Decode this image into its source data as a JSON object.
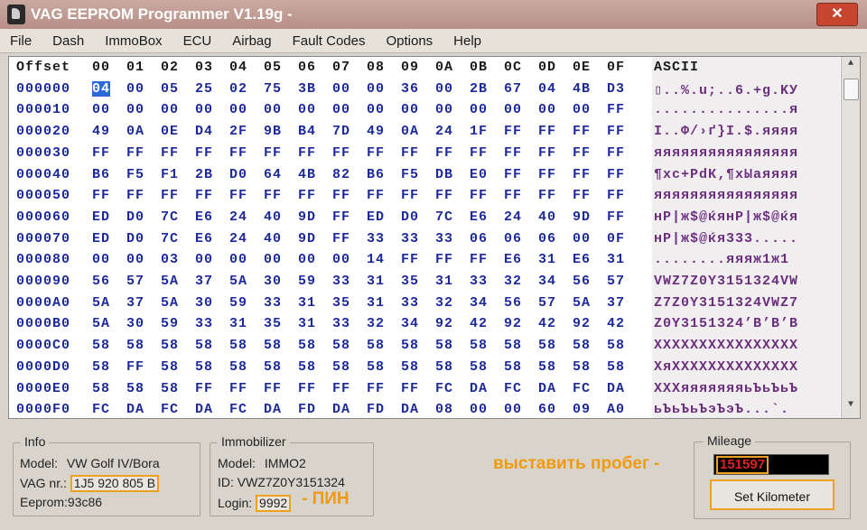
{
  "window": {
    "title": "VAG EEPROM Programmer  V1.19g -",
    "close_label": "✕"
  },
  "menu": [
    "File",
    "Dash",
    "ImmoBox",
    "ECU",
    "Airbag",
    "Fault Codes",
    "Options",
    "Help"
  ],
  "hex_view": {
    "header": [
      "Offset",
      "00",
      "01",
      "02",
      "03",
      "04",
      "05",
      "06",
      "07",
      "08",
      "09",
      "0A",
      "0B",
      "0C",
      "0D",
      "0E",
      "0F"
    ],
    "ascii_header": "ASCII",
    "rows": [
      {
        "offset": "000000",
        "bytes": [
          "04",
          "00",
          "05",
          "25",
          "02",
          "75",
          "3B",
          "00",
          "00",
          "36",
          "00",
          "2B",
          "67",
          "04",
          "4B",
          "D3"
        ],
        "ascii": "▯..%.u;..6.+g.KУ"
      },
      {
        "offset": "000010",
        "bytes": [
          "00",
          "00",
          "00",
          "00",
          "00",
          "00",
          "00",
          "00",
          "00",
          "00",
          "00",
          "00",
          "00",
          "00",
          "00",
          "FF"
        ],
        "ascii": "...............я"
      },
      {
        "offset": "000020",
        "bytes": [
          "49",
          "0A",
          "0E",
          "D4",
          "2F",
          "9B",
          "B4",
          "7D",
          "49",
          "0A",
          "24",
          "1F",
          "FF",
          "FF",
          "FF",
          "FF"
        ],
        "ascii": "I..Ф/›ґ}I.$.яяяя"
      },
      {
        "offset": "000030",
        "bytes": [
          "FF",
          "FF",
          "FF",
          "FF",
          "FF",
          "FF",
          "FF",
          "FF",
          "FF",
          "FF",
          "FF",
          "FF",
          "FF",
          "FF",
          "FF",
          "FF"
        ],
        "ascii": "яяяяяяяяяяяяяяяя"
      },
      {
        "offset": "000040",
        "bytes": [
          "B6",
          "F5",
          "F1",
          "2B",
          "D0",
          "64",
          "4B",
          "82",
          "B6",
          "F5",
          "DB",
          "E0",
          "FF",
          "FF",
          "FF",
          "FF"
        ],
        "ascii": "¶хс+РdК‚¶хЫаяяяя"
      },
      {
        "offset": "000050",
        "bytes": [
          "FF",
          "FF",
          "FF",
          "FF",
          "FF",
          "FF",
          "FF",
          "FF",
          "FF",
          "FF",
          "FF",
          "FF",
          "FF",
          "FF",
          "FF",
          "FF"
        ],
        "ascii": "яяяяяяяяяяяяяяяя"
      },
      {
        "offset": "000060",
        "bytes": [
          "ED",
          "D0",
          "7C",
          "E6",
          "24",
          "40",
          "9D",
          "FF",
          "ED",
          "D0",
          "7C",
          "E6",
          "24",
          "40",
          "9D",
          "FF"
        ],
        "ascii": "нР|ж$@ќянР|ж$@ќя"
      },
      {
        "offset": "000070",
        "bytes": [
          "ED",
          "D0",
          "7C",
          "E6",
          "24",
          "40",
          "9D",
          "FF",
          "33",
          "33",
          "33",
          "06",
          "06",
          "06",
          "00",
          "0F"
        ],
        "ascii": "нР|ж$@ќя333....."
      },
      {
        "offset": "000080",
        "bytes": [
          "00",
          "00",
          "03",
          "00",
          "00",
          "00",
          "00",
          "00",
          "14",
          "FF",
          "FF",
          "FF",
          "E6",
          "31",
          "E6",
          "31"
        ],
        "ascii": "........яяяж1ж1"
      },
      {
        "offset": "000090",
        "bytes": [
          "56",
          "57",
          "5A",
          "37",
          "5A",
          "30",
          "59",
          "33",
          "31",
          "35",
          "31",
          "33",
          "32",
          "34",
          "56",
          "57"
        ],
        "ascii": "VWZ7Z0Y3151324VW"
      },
      {
        "offset": "0000A0",
        "bytes": [
          "5A",
          "37",
          "5A",
          "30",
          "59",
          "33",
          "31",
          "35",
          "31",
          "33",
          "32",
          "34",
          "56",
          "57",
          "5A",
          "37"
        ],
        "ascii": "Z7Z0Y3151324VWZ7"
      },
      {
        "offset": "0000B0",
        "bytes": [
          "5A",
          "30",
          "59",
          "33",
          "31",
          "35",
          "31",
          "33",
          "32",
          "34",
          "92",
          "42",
          "92",
          "42",
          "92",
          "42"
        ],
        "ascii": "Z0Y3151324’B’B’B"
      },
      {
        "offset": "0000C0",
        "bytes": [
          "58",
          "58",
          "58",
          "58",
          "58",
          "58",
          "58",
          "58",
          "58",
          "58",
          "58",
          "58",
          "58",
          "58",
          "58",
          "58"
        ],
        "ascii": "XXXXXXXXXXXXXXXX"
      },
      {
        "offset": "0000D0",
        "bytes": [
          "58",
          "FF",
          "58",
          "58",
          "58",
          "58",
          "58",
          "58",
          "58",
          "58",
          "58",
          "58",
          "58",
          "58",
          "58",
          "58"
        ],
        "ascii": "XяXXXXXXXXXXXXXX"
      },
      {
        "offset": "0000E0",
        "bytes": [
          "58",
          "58",
          "58",
          "FF",
          "FF",
          "FF",
          "FF",
          "FF",
          "FF",
          "FF",
          "FC",
          "DA",
          "FC",
          "DA",
          "FC",
          "DA"
        ],
        "ascii": "XXXяяяяяяяьЪьЪьЪ"
      },
      {
        "offset": "0000F0",
        "bytes": [
          "FC",
          "DA",
          "FC",
          "DA",
          "FC",
          "DA",
          "FD",
          "DA",
          "FD",
          "DA",
          "08",
          "00",
          "00",
          "60",
          "09",
          "A0"
        ],
        "ascii": "ьЪьЪьЪэЪэЪ...`. "
      }
    ]
  },
  "info": {
    "title": "Info",
    "model_label": "Model:",
    "model_value": "VW Golf IV/Bora",
    "vag_label": "VAG nr.:",
    "vag_value": "1J5 920 805 B",
    "eeprom_label": "Eeprom:",
    "eeprom_value": "93c86"
  },
  "immobilizer": {
    "title": "Immobilizer",
    "model_label": "Model:",
    "model_value": "IMMO2",
    "id_label": "ID:",
    "id_value": "VWZ7Z0Y3151324",
    "login_label": "Login:",
    "login_value": "9992",
    "pin_annotation": "- ПИН"
  },
  "mileage": {
    "title": "Mileage",
    "value": "151597",
    "annotation": "выставить пробег -",
    "set_button": "Set Kilometer"
  },
  "colors": {
    "hex_text": "#1d2a9a",
    "ascii_text": "#6b2f7e",
    "highlight": "#f0a020",
    "mileage_digits": "#e02020"
  }
}
